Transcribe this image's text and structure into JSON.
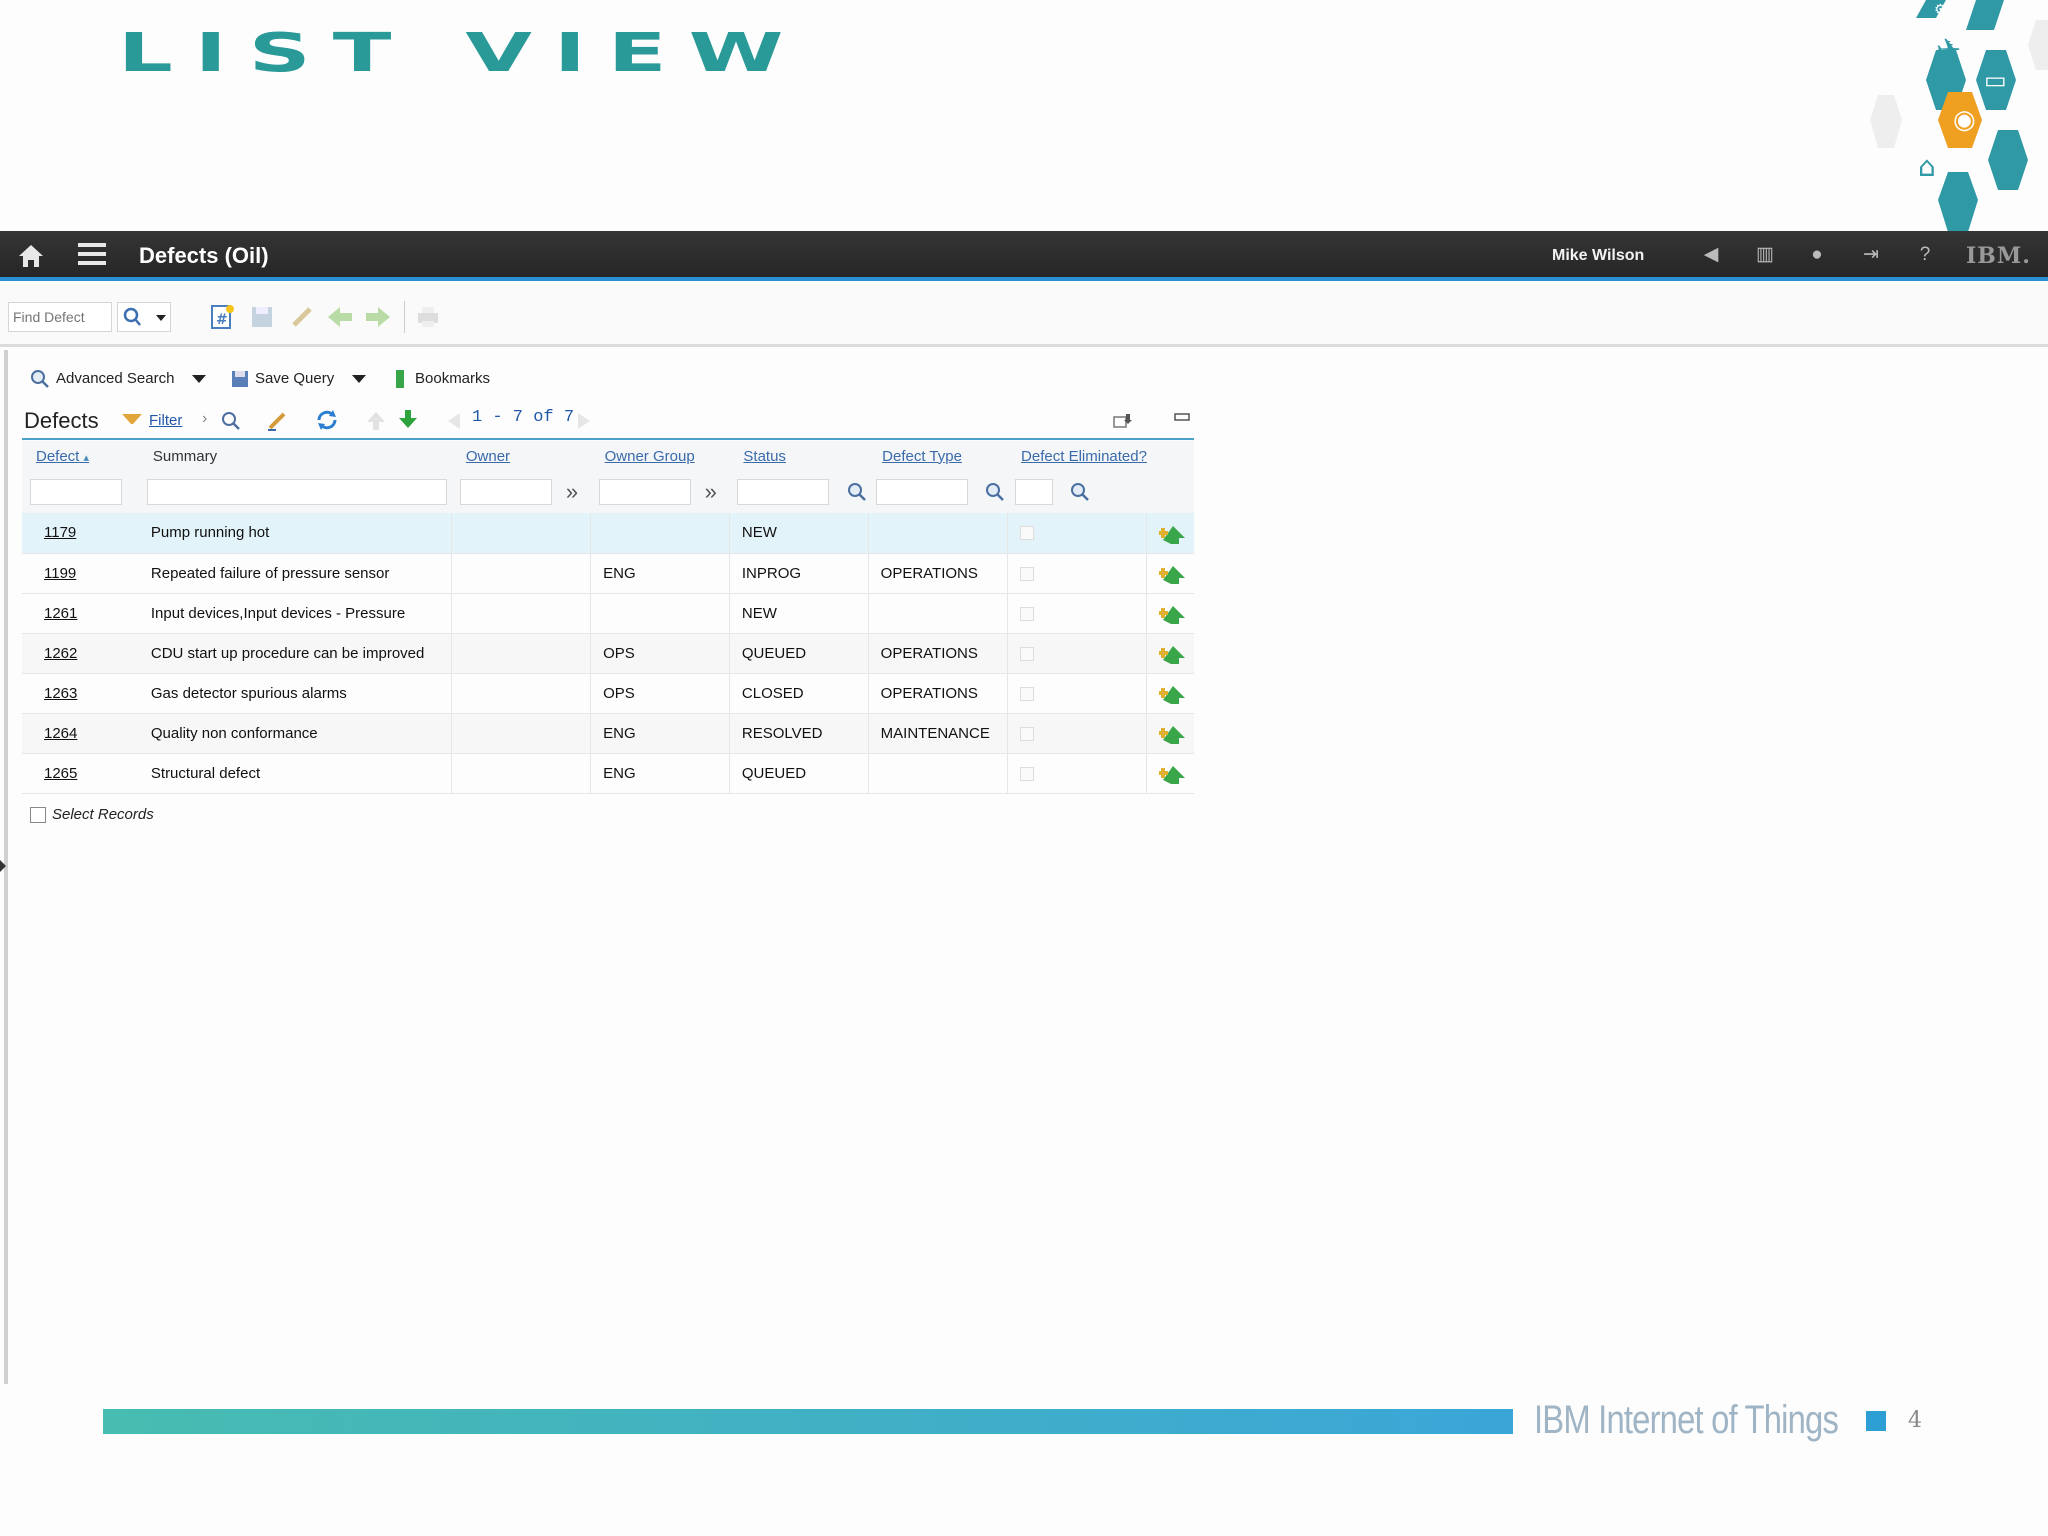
{
  "slide": {
    "title": "LIST VIEW",
    "footer_brand": "IBM Internet of Things",
    "page_number": "4"
  },
  "appbar": {
    "title": "Defects (Oil)",
    "user": "Mike Wilson",
    "brand": "IBM."
  },
  "toolbar": {
    "find_placeholder": "Find Defect"
  },
  "query": {
    "advanced_search": "Advanced Search",
    "save_query": "Save Query",
    "bookmarks": "Bookmarks"
  },
  "table": {
    "title": "Defects",
    "filter_link": "Filter",
    "pager": "1 - 7 of 7",
    "columns": [
      "Defect",
      "Summary",
      "Owner",
      "Owner Group",
      "Status",
      "Defect Type",
      "Defect Eliminated?"
    ],
    "rows": [
      {
        "id": "1179",
        "summary": "Pump running hot",
        "owner": "",
        "group": "",
        "status": "NEW",
        "type": ""
      },
      {
        "id": "1199",
        "summary": "Repeated failure of pressure sensor",
        "owner": "",
        "group": "ENG",
        "status": "INPROG",
        "type": "OPERATIONS"
      },
      {
        "id": "1261",
        "summary": "Input devices,Input devices - Pressure",
        "owner": "",
        "group": "",
        "status": "NEW",
        "type": ""
      },
      {
        "id": "1262",
        "summary": "CDU start up procedure can be improved",
        "owner": "",
        "group": "OPS",
        "status": "QUEUED",
        "type": "OPERATIONS"
      },
      {
        "id": "1263",
        "summary": "Gas detector spurious alarms",
        "owner": "",
        "group": "OPS",
        "status": "CLOSED",
        "type": "OPERATIONS"
      },
      {
        "id": "1264",
        "summary": "Quality non conformance",
        "owner": "",
        "group": "ENG",
        "status": "RESOLVED",
        "type": "MAINTENANCE"
      },
      {
        "id": "1265",
        "summary": "Structural defect",
        "owner": "",
        "group": "ENG",
        "status": "QUEUED",
        "type": ""
      }
    ],
    "select_records": "Select Records"
  },
  "colors": {
    "accent_teal": "#2a9a98",
    "appbar_bg": "#2e2e2e",
    "appbar_underline": "#2b8fd6",
    "link_blue": "#2158a8",
    "row_selected": "#e3f3fa"
  }
}
